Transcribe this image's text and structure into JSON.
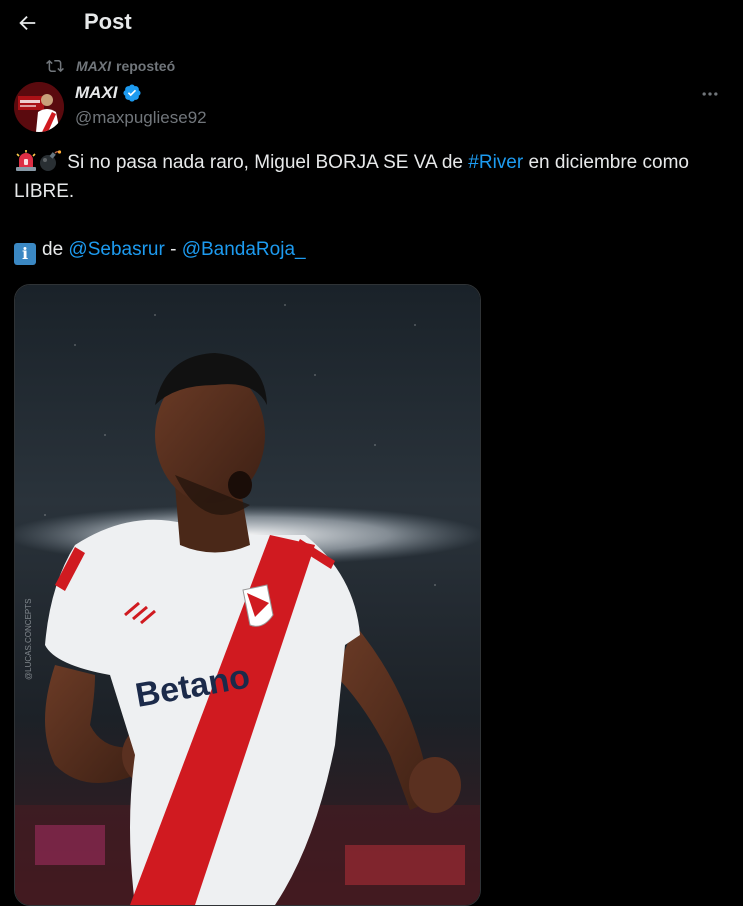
{
  "header": {
    "title": "Post",
    "back_icon": "arrow-left-icon"
  },
  "repost": {
    "icon": "repost-icon",
    "reposter": "MAXI",
    "action": "reposteó"
  },
  "author": {
    "name": "MAXI",
    "handle": "@maxpugliese92",
    "verified": true,
    "verified_color": "#1d9bf0",
    "more_icon": "more-dots-icon"
  },
  "tweet": {
    "emojis_start": [
      "rotating-light-emoji",
      "bomb-emoji"
    ],
    "text_before_hashtag": "Si no pasa nada raro, Miguel BORJA SE VA de ",
    "hashtag": "#River",
    "text_after_hashtag": " en diciembre como LIBRE.",
    "info_emoji": "information-emoji",
    "source_prefix": "de ",
    "mention_1": "@Sebasrur",
    "separator": " - ",
    "mention_2": "@BandaRoja_"
  },
  "media": {
    "image_subject": "photo-football-player-celebrating",
    "jersey_sponsor": "Betano",
    "watermark": "@LUCAS.CONCEPTS"
  },
  "colors": {
    "background": "#000000",
    "text": "#e7e9ea",
    "secondary_text": "#71767b",
    "link": "#1d9bf0"
  }
}
